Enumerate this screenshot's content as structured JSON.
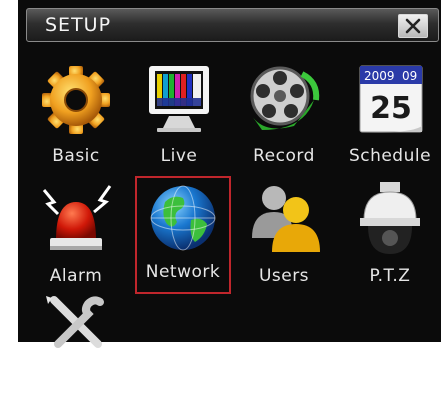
{
  "window": {
    "title": "SETUP",
    "close_label": "X"
  },
  "menu": {
    "items": [
      {
        "label": "Basic",
        "icon": "gear-icon"
      },
      {
        "label": "Live",
        "icon": "monitor-icon"
      },
      {
        "label": "Record",
        "icon": "film-reel-icon"
      },
      {
        "label": "Schedule",
        "icon": "calendar-icon"
      },
      {
        "label": "Alarm",
        "icon": "alarm-siren-icon"
      },
      {
        "label": "Network",
        "icon": "globe-icon"
      },
      {
        "label": "Users",
        "icon": "users-icon"
      },
      {
        "label": "P.T.Z",
        "icon": "ptz-camera-icon"
      },
      {
        "label": "",
        "icon": "tools-icon"
      }
    ],
    "selected": "Network"
  },
  "calendar": {
    "year": "2009",
    "month": "09",
    "day": "25"
  },
  "colors": {
    "selection_border": "#c0262c",
    "background": "#0b0b0b"
  }
}
